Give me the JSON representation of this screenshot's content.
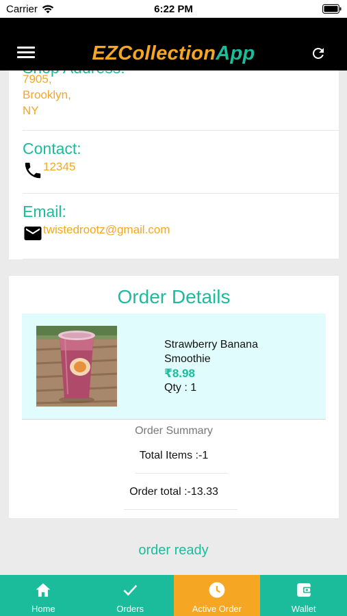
{
  "status_bar": {
    "carrier": "Carrier",
    "time": "6:22 PM"
  },
  "header": {
    "title_part1": "EZCollection",
    "title_part2": "App"
  },
  "shop": {
    "address_label": "Shop Address:",
    "address_lines": [
      "7905,",
      "Brooklyn,",
      "NY"
    ],
    "contact_label": "Contact:",
    "contact_value": "12345",
    "email_label": "Email:",
    "email_value": "twistedrootz@gmail.com"
  },
  "order": {
    "title": "Order Details",
    "item": {
      "name": "Strawberry Banana Smoothie",
      "price": "₹8.98",
      "qty": "Qty : 1"
    },
    "summary_title": "Order Summary",
    "total_items": "Total Items :-1",
    "order_total": "Order total :-13.33"
  },
  "order_status": "order ready",
  "tabs": [
    {
      "label": "Home",
      "icon": "home-icon",
      "active": false
    },
    {
      "label": "Orders",
      "icon": "check-icon",
      "active": false
    },
    {
      "label": "Active Order",
      "icon": "clock-icon",
      "active": true
    },
    {
      "label": "Wallet",
      "icon": "wallet-icon",
      "active": false
    }
  ],
  "colors": {
    "teal": "#1abc9c",
    "orange": "#f5a623",
    "header_bg": "#000000",
    "item_bg": "#e0fcfc"
  }
}
